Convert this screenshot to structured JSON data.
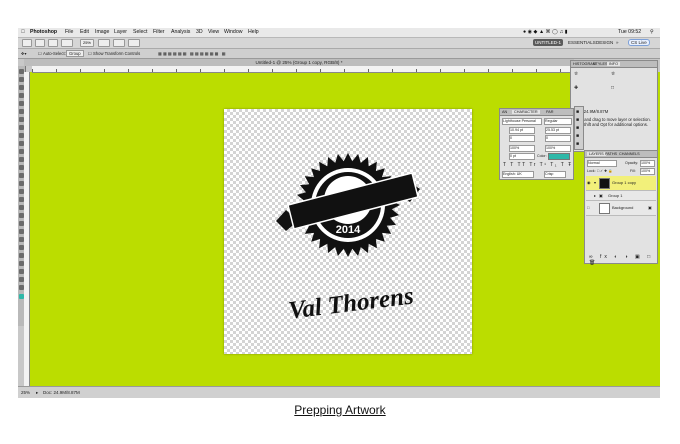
{
  "caption": "Prepping Artwork",
  "menubar": {
    "app_name": "Photoshop",
    "items": [
      "File",
      "Edit",
      "Image",
      "Layer",
      "Select",
      "Filter",
      "Analysis",
      "3D",
      "View",
      "Window",
      "Help"
    ],
    "clock": "Tue 09:52"
  },
  "appbar": {
    "zoom": "25%",
    "workspace_active": "UNTITLED-1",
    "workspace_items": [
      "ESSENTIALS",
      "DESIGN"
    ],
    "cs_live": "CS Live"
  },
  "options_bar": {
    "auto_select": "Auto-Select:",
    "auto_select_value": "Group",
    "show_transform": "Show Transform Controls"
  },
  "document": {
    "title": "Untitled-1 @ 25% (Group 1 copy, RGB/8) *",
    "badge_year": "2014",
    "script_text": "Val Thorens"
  },
  "status_bar": {
    "zoom": "25%",
    "doc_size": "Doc: 24.9M/8.87M"
  },
  "info_panel": {
    "tabs": [
      "HISTOGRAM",
      "STYLES",
      "INFO"
    ],
    "doc_info": "Doc: 24.9M/8.87M",
    "hint": "Click and drag to move layer or selection. Use Shift and Opt for additional options."
  },
  "character_panel": {
    "tabs": [
      "AN",
      "CHARACTER",
      "PAR"
    ],
    "font_family": "Lighthouse Personal",
    "font_style": "Regular",
    "size": "10.94 pt",
    "leading": "25.53 pt",
    "kerning": "0",
    "tracking": "0",
    "vscale": "100%",
    "hscale": "100%",
    "baseline": "0 pt",
    "color_label": "Color:",
    "language": "English: UK",
    "aa": "Crisp"
  },
  "layers_panel": {
    "tabs": [
      "LAYERS",
      "PATHS",
      "CHANNELS"
    ],
    "blend_mode": "Normal",
    "opacity_label": "Opacity:",
    "opacity": "100%",
    "lock_label": "Lock:",
    "fill_label": "Fill:",
    "fill": "100%",
    "layers": [
      {
        "name": "Group 1 copy",
        "selected": true
      },
      {
        "name": "Group 1",
        "selected": false
      },
      {
        "name": "Background",
        "selected": false
      }
    ]
  },
  "colors": {
    "canvas_background": "#bbdd00",
    "selected_layer": "#f2f07a"
  }
}
